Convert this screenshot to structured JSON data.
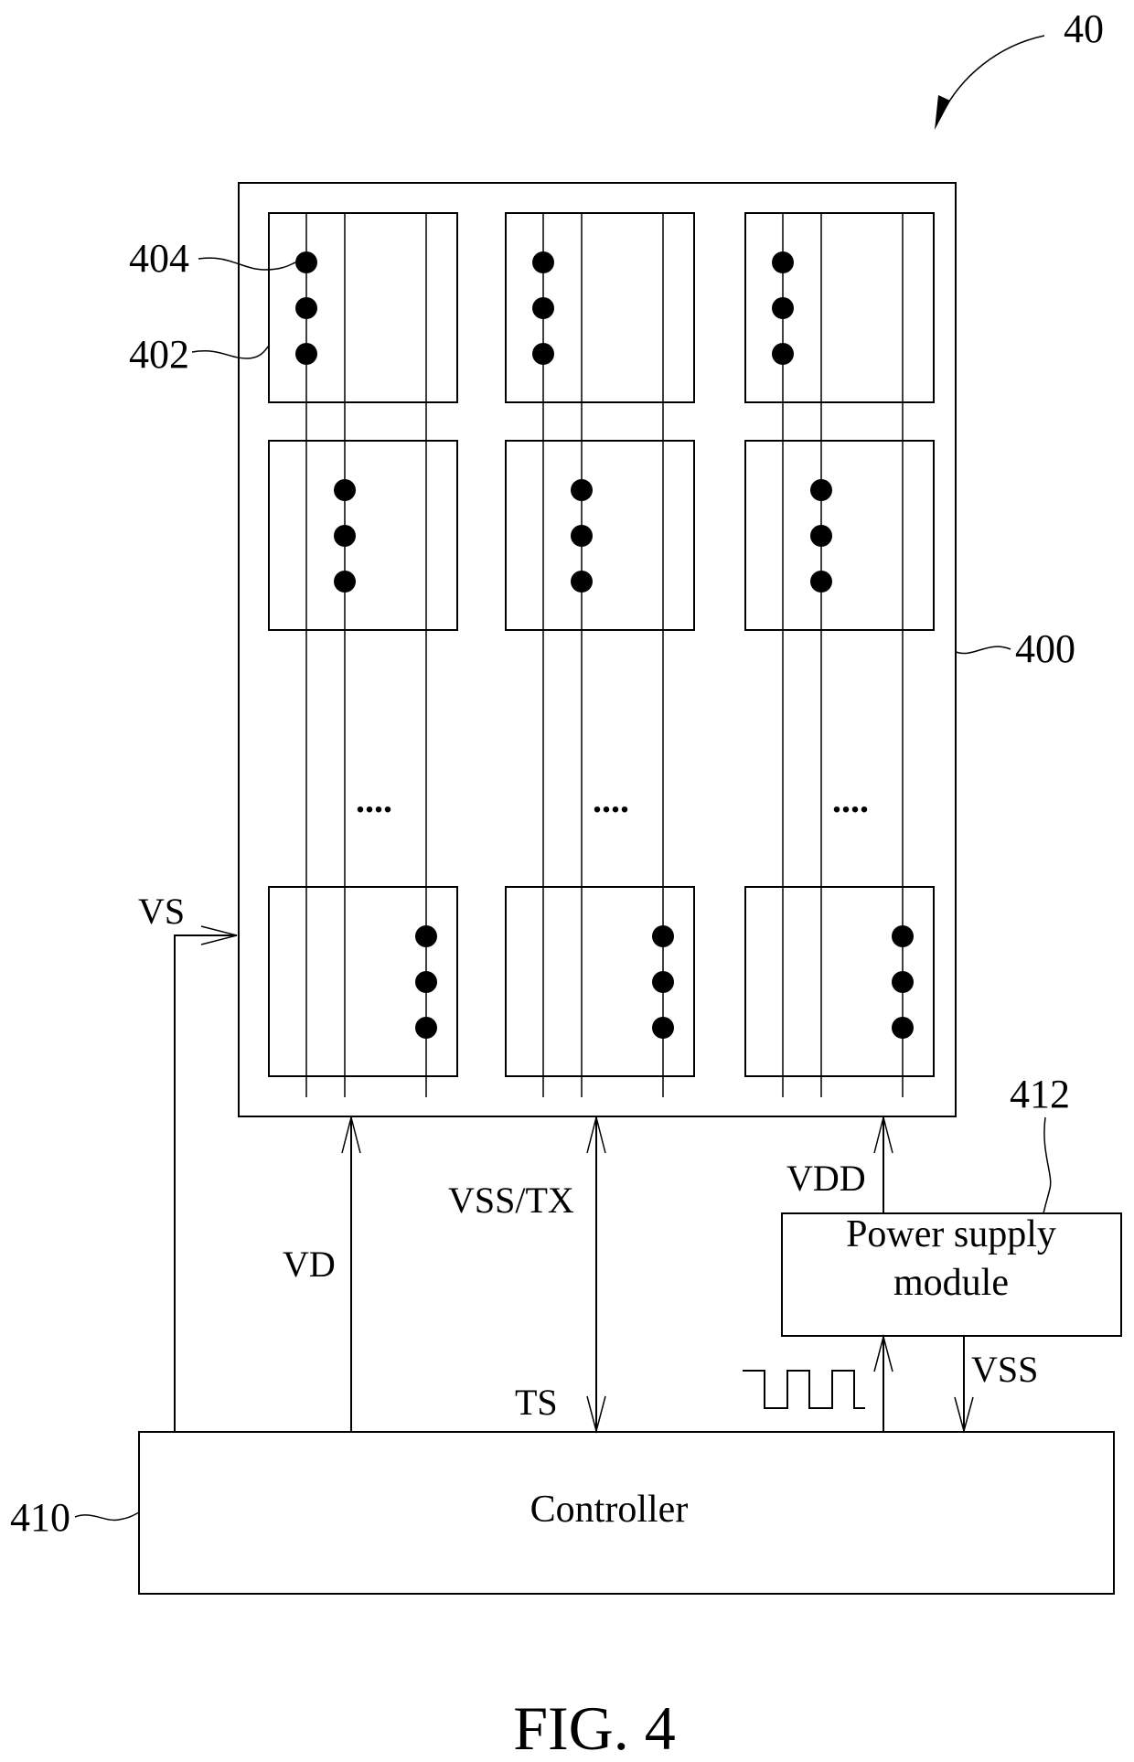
{
  "figure": {
    "caption": "FIG. 4",
    "reference": "40"
  },
  "colors": {
    "ink": "#000000",
    "background": "#ffffff"
  },
  "panel": {
    "reference": "400",
    "cell_reference": "402",
    "dot_reference": "404",
    "columns": 3,
    "rows_shown": 3,
    "ellipsis": "....",
    "dots_per_cell": 3,
    "rows_active_line": [
      1,
      2,
      3
    ]
  },
  "signals": {
    "vs": "VS",
    "vd": "VD",
    "vss_tx": "VSS/TX",
    "ts": "TS",
    "vdd": "VDD",
    "vss": "VSS"
  },
  "power_supply": {
    "reference": "412",
    "line1": "Power supply",
    "line2": "module"
  },
  "controller": {
    "reference": "410",
    "label": "Controller"
  }
}
